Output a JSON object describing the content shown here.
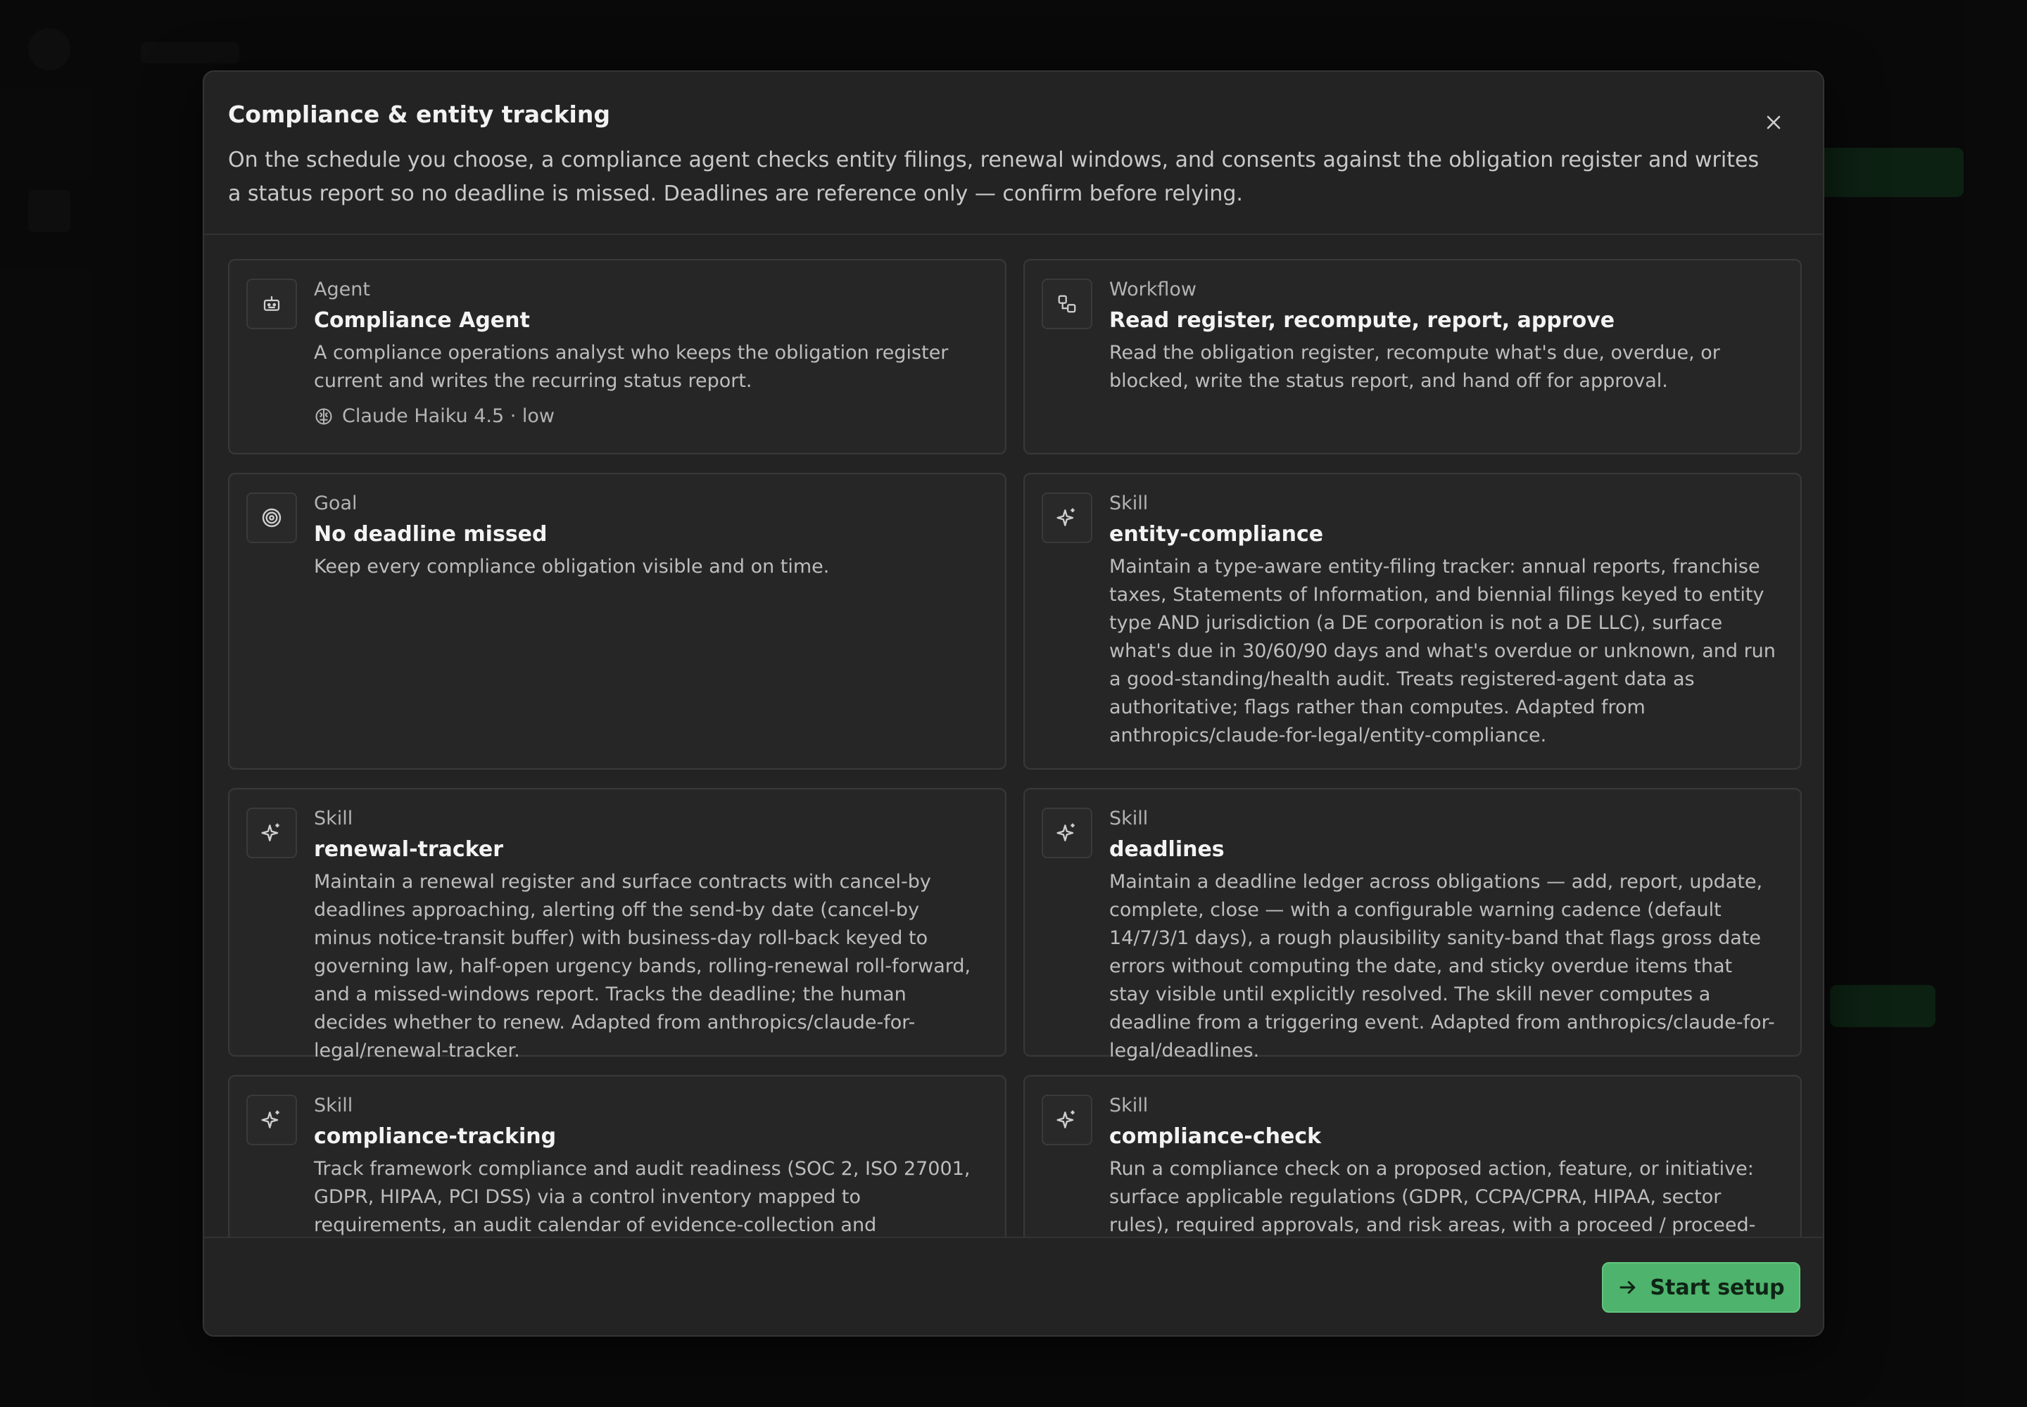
{
  "modal": {
    "title": "Compliance & entity tracking",
    "description": "On the schedule you choose, a compliance agent checks entity filings, renewal windows, and consents against the obligation register and writes a status report so no deadline is missed. Deadlines are reference only — confirm before relying.",
    "close_icon": "close-icon"
  },
  "cards": [
    {
      "kind": "Agent",
      "name": "Compliance Agent",
      "description": "A compliance operations analyst who keeps the obligation register current and writes the recurring status report.",
      "icon": "robot-icon",
      "meta": "Claude Haiku 4.5 · low",
      "meta_icon": "brain-icon"
    },
    {
      "kind": "Workflow",
      "name": "Read register, recompute, report, approve",
      "description": "Read the obligation register, recompute what's due, overdue, or blocked, write the status report, and hand off for approval.",
      "icon": "workflow-icon"
    },
    {
      "kind": "Goal",
      "name": "No deadline missed",
      "description": "Keep every compliance obligation visible and on time.",
      "icon": "target-icon"
    },
    {
      "kind": "Skill",
      "name": "entity-compliance",
      "description": "Maintain a type-aware entity-filing tracker: annual reports, franchise taxes, Statements of Information, and biennial filings keyed to entity type AND jurisdiction (a DE corporation is not a DE LLC), surface what's due in 30/60/90 days and what's overdue or unknown, and run a good-standing/health audit. Treats registered-agent data as authoritative; flags rather than computes. Adapted from anthropics/claude-for-legal/entity-compliance.",
      "icon": "sparkle-icon"
    },
    {
      "kind": "Skill",
      "name": "renewal-tracker",
      "description": "Maintain a renewal register and surface contracts with cancel-by deadlines approaching, alerting off the send-by date (cancel-by minus notice-transit buffer) with business-day roll-back keyed to governing law, half-open urgency bands, rolling-renewal roll-forward, and a missed-windows report. Tracks the deadline; the human decides whether to renew. Adapted from anthropics/claude-for-legal/renewal-tracker.",
      "icon": "sparkle-icon"
    },
    {
      "kind": "Skill",
      "name": "deadlines",
      "description": "Maintain a deadline ledger across obligations — add, report, update, complete, close — with a configurable warning cadence (default 14/7/3/1 days), a rough plausibility sanity-band that flags gross date errors without computing the date, and sticky overdue items that stay visible until explicitly resolved. The skill never computes a deadline from a triggering event. Adapted from anthropics/claude-for-legal/deadlines.",
      "icon": "sparkle-icon"
    },
    {
      "kind": "Skill",
      "name": "compliance-tracking",
      "description": "Track framework compliance and audit readiness (SOC 2, ISO 27001, GDPR, HIPAA, PCI DSS) via a control inventory mapped to requirements, an audit calendar of evidence-collection and remediation deadlines,",
      "icon": "sparkle-icon"
    },
    {
      "kind": "Skill",
      "name": "compliance-check",
      "description": "Run a compliance check on a proposed action, feature, or initiative: surface applicable regulations (GDPR, CCPA/CPRA, HIPAA, sector rules), required approvals, and risk areas, with a proceed / proceed-with-conditions /",
      "icon": "sparkle-icon"
    }
  ],
  "footer": {
    "start_label": "Start setup",
    "start_icon": "arrow-right-icon"
  },
  "colors": {
    "accent": "#4eb36c",
    "modal_bg": "#232323",
    "card_bg": "#262626"
  }
}
